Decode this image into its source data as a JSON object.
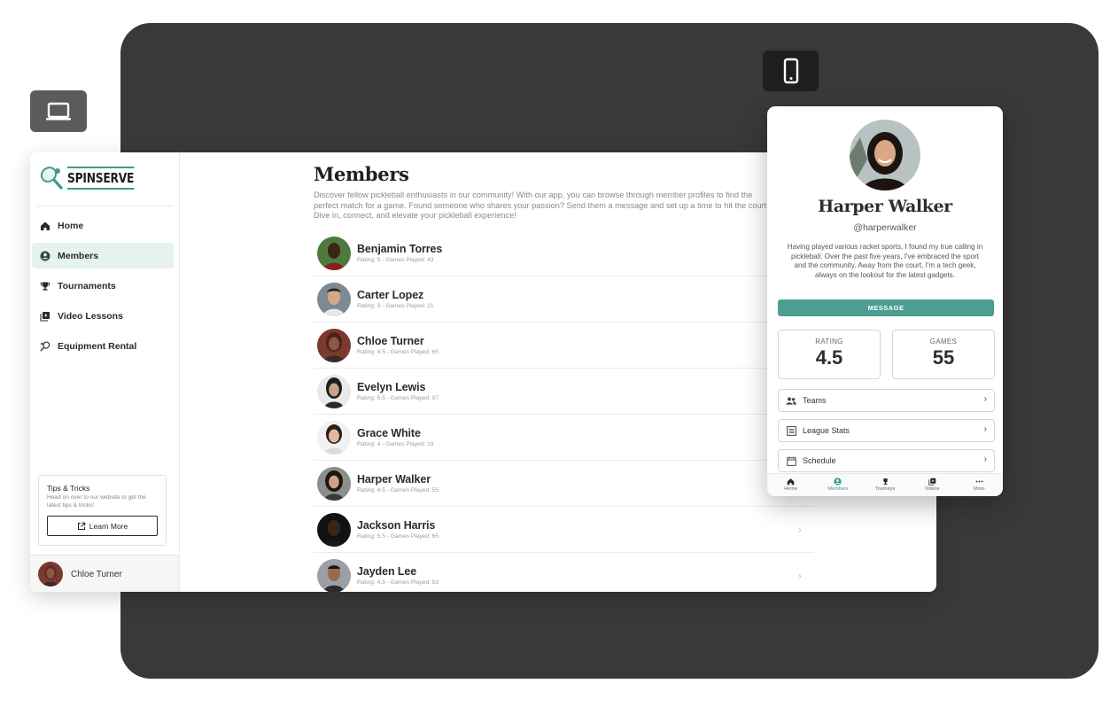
{
  "brand": {
    "logo_text": "SPINSERVE"
  },
  "sidebar": {
    "items": [
      {
        "label": "Home",
        "icon": "home-icon",
        "active": false
      },
      {
        "label": "Members",
        "icon": "person-circle-icon",
        "active": true
      },
      {
        "label": "Tournaments",
        "icon": "trophy-icon",
        "active": false
      },
      {
        "label": "Video Lessons",
        "icon": "video-library-icon",
        "active": false
      },
      {
        "label": "Equipment Rental",
        "icon": "paddle-icon",
        "active": false
      }
    ],
    "tips": {
      "title": "Tips & Tricks",
      "body": "Head on over to our website to get the latest tips & tricks!",
      "button_label": "Learn More"
    },
    "current_user": {
      "name": "Chloe Turner"
    }
  },
  "main": {
    "title": "Members",
    "description": "Discover fellow pickleball enthusiasts in our community! With our app, you can browse through member profiles to find the perfect match for a game. Found someone who shares your passion? Send them a message and set up a time to hit the courts. Dive in, connect, and elevate your pickleball experience!",
    "members": [
      {
        "name": "Benjamin Torres",
        "meta": "Rating: 5 - Games Played: 43"
      },
      {
        "name": "Carter Lopez",
        "meta": "Rating: 3 - Games Played: 21"
      },
      {
        "name": "Chloe Turner",
        "meta": "Rating: 4.5 - Games Played: 65"
      },
      {
        "name": "Evelyn Lewis",
        "meta": "Rating: 5.5 - Games Played: 97"
      },
      {
        "name": "Grace White",
        "meta": "Rating: 4 - Games Played: 19"
      },
      {
        "name": "Harper Walker",
        "meta": "Rating: 4.5 - Games Played: 55"
      },
      {
        "name": "Jackson Harris",
        "meta": "Rating: 5.5 - Games Played: 65"
      },
      {
        "name": "Jayden Lee",
        "meta": "Rating: 4.5 - Games Played: 53"
      }
    ]
  },
  "profile": {
    "name": "Harper Walker",
    "handle": "@harperwalker",
    "bio": "Having played various racket sports, I found my true calling in pickleball. Over the past five years, I've embraced the sport and the community. Away from the court, I'm a tech geek, always on the lookout for the latest gadgets.",
    "message_label": "MESSAGE",
    "rating_label": "RATING",
    "rating_value": "4.5",
    "games_label": "GAMES",
    "games_value": "55",
    "links": [
      {
        "label": "Teams",
        "icon": "group-icon"
      },
      {
        "label": "League Stats",
        "icon": "list-icon"
      },
      {
        "label": "Schedule",
        "icon": "calendar-icon"
      }
    ],
    "tabs": [
      {
        "label": "Home",
        "icon": "home-icon",
        "active": false
      },
      {
        "label": "Members",
        "icon": "person-circle-icon",
        "active": true
      },
      {
        "label": "Tourneys",
        "icon": "trophy-icon",
        "active": false
      },
      {
        "label": "Videos",
        "icon": "video-library-icon",
        "active": false
      },
      {
        "label": "More",
        "icon": "more-icon",
        "active": false
      }
    ]
  },
  "colors": {
    "accent": "#4b9e91",
    "active_bg": "#e6f2ef",
    "backdrop": "#393939"
  }
}
